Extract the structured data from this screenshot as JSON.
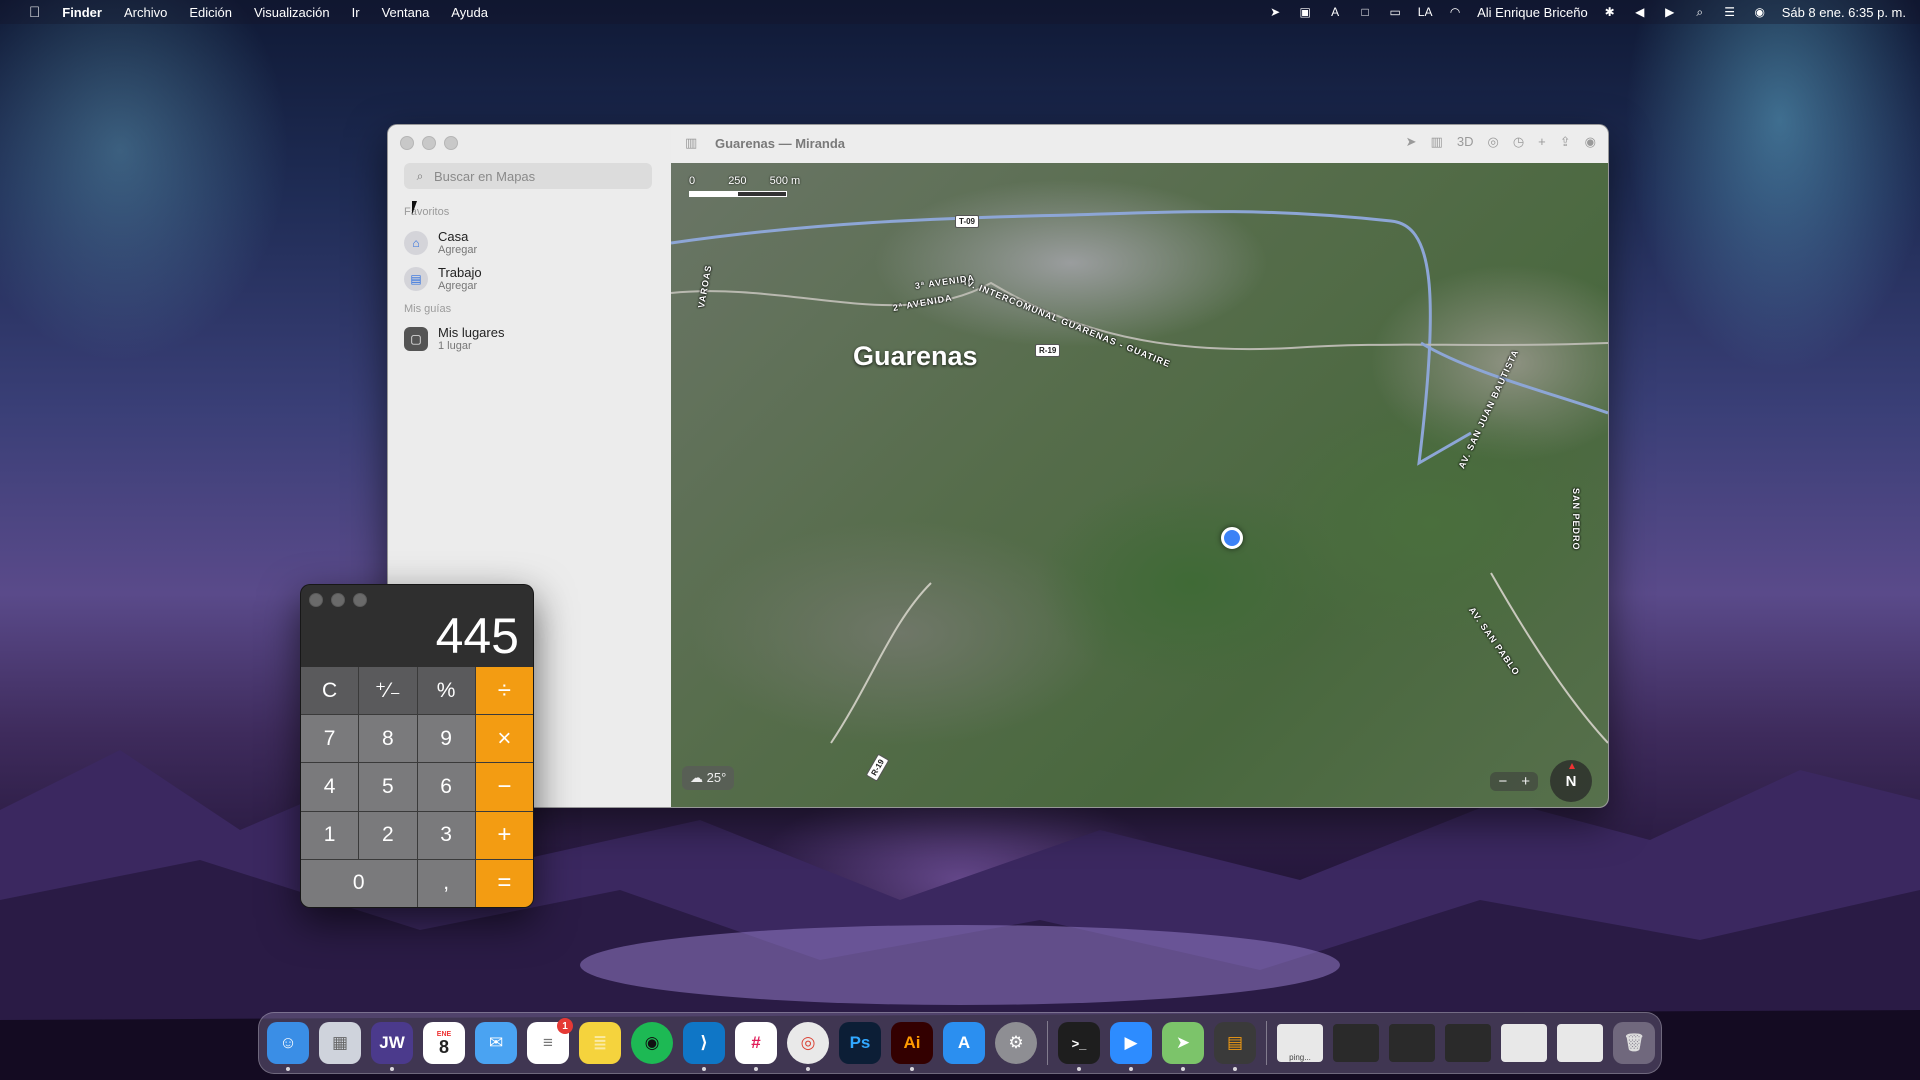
{
  "menubar": {
    "apple": "",
    "app": "Finder",
    "menus": [
      "Archivo",
      "Edición",
      "Visualización",
      "Ir",
      "Ventana",
      "Ayuda"
    ],
    "user": "Ali Enrique Briceño",
    "datetime": "Sáb 8 ene.  6:35 p. m."
  },
  "maps": {
    "title": "Guarenas — Miranda",
    "search_placeholder": "Buscar en Mapas",
    "favorites_header": "Favoritos",
    "favorites": [
      {
        "label": "Casa",
        "sub": "Agregar"
      },
      {
        "label": "Trabajo",
        "sub": "Agregar"
      }
    ],
    "guides_header": "Mis guías",
    "guides": [
      {
        "label": "Mis lugares",
        "sub": "1 lugar"
      }
    ],
    "toolbar_3d": "3D",
    "scale": {
      "t0": "0",
      "t1": "250",
      "t2": "500 m"
    },
    "city_label": "Guarenas",
    "roads": {
      "intercomunal": "AV. INTERCOMUNAL GUARENAS - GUATIRE",
      "tercera": "3ª AVENIDA",
      "segunda": "2ª AVENIDA",
      "varoas": "VAROAS",
      "san_juan": "AV. SAN JUAN BAUTISTA",
      "san_pablo": "AV. SAN PABLO",
      "san_pedro": "SAN PEDRO"
    },
    "shields": {
      "t09": "T-09",
      "r19": "R-19",
      "r19b": "R-19"
    },
    "weather": "25°",
    "zoom_out": "−",
    "zoom_in": "+",
    "compass": "N"
  },
  "calculator": {
    "display": "445",
    "keys": [
      "C",
      "⁺∕₋",
      "%",
      "÷",
      "7",
      "8",
      "9",
      "×",
      "4",
      "5",
      "6",
      "−",
      "1",
      "2",
      "3",
      "+",
      "0",
      ",",
      "="
    ]
  },
  "dock": {
    "apps": [
      {
        "name": "Finder",
        "glyph": "☺",
        "color": "#3a8ee6"
      },
      {
        "name": "Launchpad",
        "glyph": "▦",
        "color": "#cfd3dc"
      },
      {
        "name": "JW Library",
        "glyph": "JW",
        "color": "#4b3a8c"
      },
      {
        "name": "Calendario",
        "glyph": "8",
        "color": "#ffffff"
      },
      {
        "name": "Mail",
        "glyph": "✉",
        "color": "#4aa3f2"
      },
      {
        "name": "Recordatorios",
        "glyph": "≡",
        "color": "#ffffff"
      },
      {
        "name": "Notas",
        "glyph": "≣",
        "color": "#f5d33d"
      },
      {
        "name": "Spotify",
        "glyph": "◉",
        "color": "#1db954"
      },
      {
        "name": "Visual Studio Code",
        "glyph": "⟩",
        "color": "#0f76c6"
      },
      {
        "name": "Slack",
        "glyph": "#",
        "color": "#ffffff"
      },
      {
        "name": "Chrome",
        "glyph": "◎",
        "color": "#e9e9e9"
      },
      {
        "name": "Photoshop",
        "glyph": "Ps",
        "color": "#0c1e36"
      },
      {
        "name": "Illustrator",
        "glyph": "Ai",
        "color": "#330000"
      },
      {
        "name": "App Store",
        "glyph": "A",
        "color": "#2b8ff0"
      },
      {
        "name": "Configuración",
        "glyph": "⚙",
        "color": "#8e8e93"
      },
      {
        "name": "Terminal",
        "glyph": ">_",
        "color": "#1e1e1e"
      },
      {
        "name": "Zoom",
        "glyph": "▶",
        "color": "#2d8cff"
      },
      {
        "name": "Mapas",
        "glyph": "➤",
        "color": "#7cc46a"
      },
      {
        "name": "Calculadora",
        "glyph": "▤",
        "color": "#3a3a3a"
      }
    ],
    "reminders_badge": "1",
    "calendar_month": "ENE",
    "minimized_label": "ping..."
  }
}
